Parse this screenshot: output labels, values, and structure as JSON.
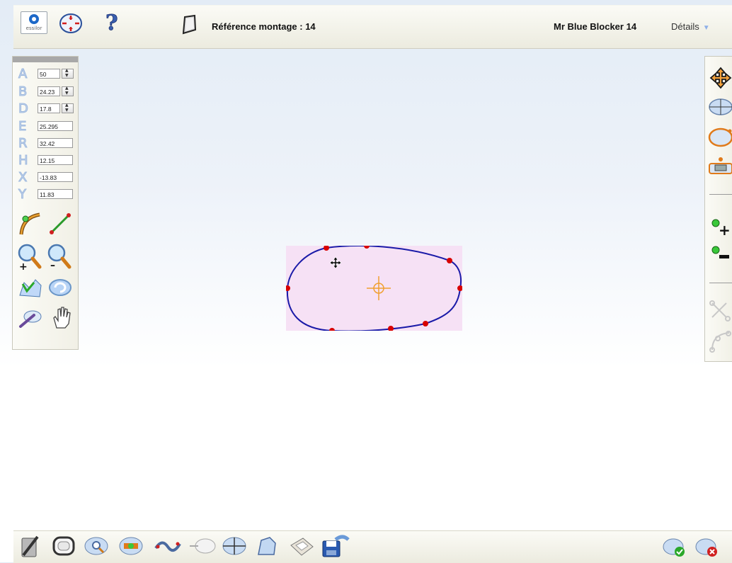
{
  "header": {
    "logo_text": "essilor",
    "reference_label": "Référence montage : 14",
    "patient_label": "Mr Blue Blocker  14",
    "details_label": "Détails",
    "details_arrow": "▼"
  },
  "params": [
    {
      "letter": "A",
      "value": "50",
      "spinner": true
    },
    {
      "letter": "B",
      "value": "24.23",
      "spinner": true
    },
    {
      "letter": "D",
      "value": "17.8",
      "spinner": true
    },
    {
      "letter": "E",
      "value": "25.295",
      "spinner": false
    },
    {
      "letter": "R",
      "value": "32.42",
      "spinner": false
    },
    {
      "letter": "H",
      "value": "12.15",
      "spinner": false
    },
    {
      "letter": "X",
      "value": "-13.83",
      "spinner": false
    },
    {
      "letter": "Y",
      "value": "11.83",
      "spinner": false
    }
  ],
  "colors": {
    "shape_stroke": "#1a1aa8",
    "shape_points": "#d80000",
    "crosshair": "#f0a030",
    "shape_fill": "#f6e1f5"
  },
  "icons": {
    "top": [
      "essilor-logo",
      "frame-center-icon",
      "help-icon",
      "lens-shape-icon"
    ],
    "left_tools": [
      "curve-edit-icon",
      "line-edit-icon",
      "zoom-in-icon",
      "zoom-out-icon",
      "reshape-icon",
      "rotate-icon",
      "measure-icon",
      "hand-pan-icon"
    ],
    "right_tools": [
      "move-icon",
      "lens-view-icon",
      "frame-view-icon",
      "frame-bridge-icon",
      "add-point-icon",
      "remove-point-icon",
      "scissors-icon",
      "curve-points-icon"
    ],
    "bottom": [
      "pen-tool-icon",
      "frame-shape-icon",
      "lens-search-icon",
      "lens-capture-icon",
      "wave-shape-icon",
      "drill-icon",
      "lens-split-icon",
      "bevel-icon",
      "scanner-icon",
      "save-icon",
      "validate-icon",
      "cancel-icon"
    ]
  }
}
